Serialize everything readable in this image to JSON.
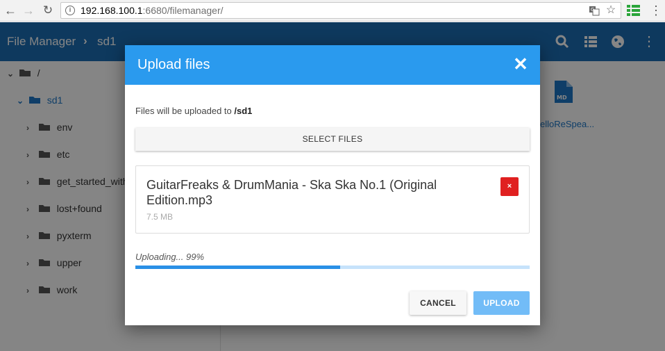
{
  "browser": {
    "url_host": "192.168.100.1",
    "url_rest": ":6680/filemanager/",
    "back_icon": "arrow-left-icon",
    "forward_icon": "arrow-right-icon",
    "reload_icon": "reload-icon"
  },
  "header": {
    "title": "File Manager",
    "breadcrumb": "sd1",
    "colors": {
      "bar": "#1c6eb4"
    }
  },
  "sidebar": {
    "root": "/",
    "items": [
      {
        "label": "sd1",
        "active": true
      },
      {
        "label": "env"
      },
      {
        "label": "etc"
      },
      {
        "label": "get_started_with"
      },
      {
        "label": "lost+found"
      },
      {
        "label": "pyxterm"
      },
      {
        "label": "upper"
      },
      {
        "label": "work"
      }
    ]
  },
  "main": {
    "file_label": "elloReSpea...",
    "file_type": "MD"
  },
  "dialog": {
    "title": "Upload files",
    "destination_prefix": "Files will be uploaded to",
    "destination_path": "/sd1",
    "select_label": "SELECT FILES",
    "file": {
      "name": "GuitarFreaks & DrumMania - Ska Ska No.1 (Original Edition.mp3",
      "size": "7.5 MB",
      "remove_label": "×"
    },
    "progress_text": "Uploading... 99%",
    "progress_fraction": 0.52,
    "cancel_label": "CANCEL",
    "upload_label": "UPLOAD",
    "colors": {
      "header": "#2a9aee",
      "upload": "#72bcf7",
      "remove": "#e02020"
    }
  }
}
